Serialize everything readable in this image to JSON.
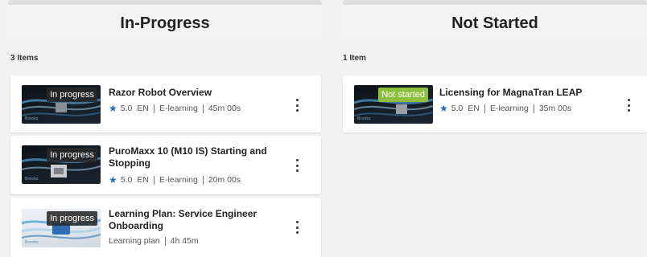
{
  "columns": {
    "in_progress": {
      "title": "In-Progress",
      "count": "3 Items",
      "items": [
        {
          "status": "In progress",
          "title": "Razor Robot Overview",
          "rating": "5.0",
          "language": "EN",
          "type": "E-learning",
          "duration": "45m 00s"
        },
        {
          "status": "In progress",
          "title": "PuroMaxx 10 (M10 IS) Starting and Stopping",
          "rating": "5.0",
          "language": "EN",
          "type": "E-learning",
          "duration": "20m 00s"
        },
        {
          "status": "In progress",
          "title": "Learning Plan: Service Engineer Onboarding",
          "type": "Learning plan",
          "duration": "4h 45m"
        }
      ]
    },
    "not_started": {
      "title": "Not Started",
      "count": "1 Item",
      "items": [
        {
          "status": "Not started",
          "title": "Licensing for MagnaTran LEAP",
          "rating": "5.0",
          "language": "EN",
          "type": "E-learning",
          "duration": "35m 00s"
        }
      ]
    }
  },
  "icons": {
    "rating": "star-icon",
    "menu": "kebab-menu-icon"
  },
  "colors": {
    "in_progress_badge": "#282828",
    "not_started_badge": "#8dbf3f",
    "star": "#1f6fb8"
  }
}
